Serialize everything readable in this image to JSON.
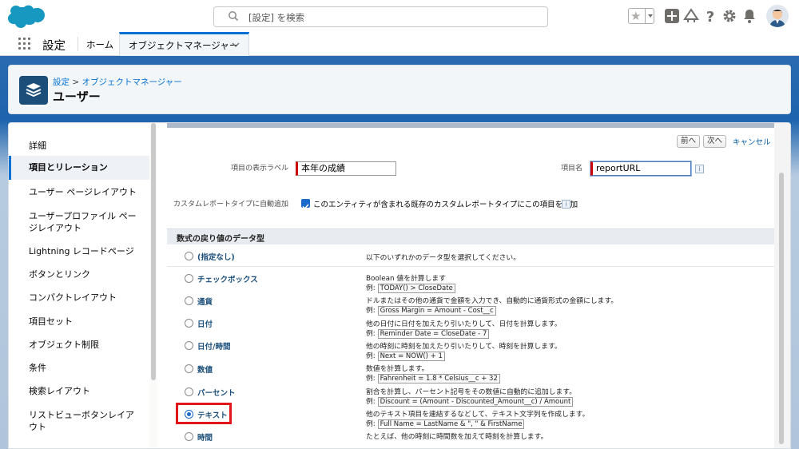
{
  "header": {
    "search_placeholder": "[設定] を検索"
  },
  "nav": {
    "app_name": "設定",
    "home": "ホーム",
    "tab": "オブジェクトマネージャー"
  },
  "page": {
    "breadcrumb_root": "設定",
    "breadcrumb_sep": ">",
    "breadcrumb_item": "オブジェクトマネージャー",
    "title": "ユーザー"
  },
  "sidebar": {
    "items": [
      {
        "label": "詳細"
      },
      {
        "label": "項目とリレーション"
      },
      {
        "label": "ユーザー ページレイアウト"
      },
      {
        "label": "ユーザープロファイル ページレイアウト"
      },
      {
        "label": "Lightning レコードページ"
      },
      {
        "label": "ボタンとリンク"
      },
      {
        "label": "コンパクトレイアウト"
      },
      {
        "label": "項目セット"
      },
      {
        "label": "オブジェクト制限"
      },
      {
        "label": "条件"
      },
      {
        "label": "検索レイアウト"
      },
      {
        "label": "リストビューボタンレイアウト"
      }
    ]
  },
  "form": {
    "prev": "前へ",
    "next": "次へ",
    "cancel": "キャンセル",
    "label_field_label": "項目の表示ラベル",
    "label_field_value": "本年の成績",
    "name_field_label": "項目名",
    "name_field_value": "reportURL",
    "auto_add_label": "カスタムレポートタイプに自動追加",
    "auto_add_text": "このエンティティが含まれる既存のカスタムレポートタイプにこの項目を追加",
    "info": "i",
    "section_title": "数式の戻り値のデータ型",
    "types": [
      {
        "label": "(指定なし)",
        "desc": "以下のいずれかのデータ型を選択してください。",
        "example": ""
      },
      {
        "label": "チェックボックス",
        "desc": "Boolean 値を計算します",
        "example": "TODAY() > CloseDate"
      },
      {
        "label": "通貨",
        "desc": "ドルまたはその他の通貨で金額を入力でき、自動的に通貨形式の金額にします。",
        "example": "Gross Margin = Amount - Cost__c"
      },
      {
        "label": "日付",
        "desc": "他の日付に日付を加えたり引いたりして、日付を計算します。",
        "example": "Reminder Date = CloseDate - 7"
      },
      {
        "label": "日付/時間",
        "desc": "他の時刻に時刻を加えたり引いたりして、時刻を計算します。",
        "example": "Next = NOW() + 1"
      },
      {
        "label": "数値",
        "desc": "数値を計算します。",
        "example": "Fahrenheit = 1.8 * Celsius__c + 32"
      },
      {
        "label": "パーセント",
        "desc": "割合を計算し、パーセント記号をその数値に自動的に追加します。",
        "example": "Discount = (Amount - Discounted_Amount__c) / Amount"
      },
      {
        "label": "テキスト",
        "desc": "他のテキスト項目を連結するなどして、テキスト文字列を作成します。",
        "example": "Full Name = LastName & \", \" & FirstName"
      },
      {
        "label": "時間",
        "desc": "たとえば、他の時刻に時間数を加えて時刻を計算します。",
        "example": ""
      }
    ],
    "example_prefix": "例:",
    "selected_type": "テキスト"
  },
  "colors": {
    "brand": "#1589ee",
    "accent": "#0070d2",
    "highlight": "#e2151b"
  }
}
